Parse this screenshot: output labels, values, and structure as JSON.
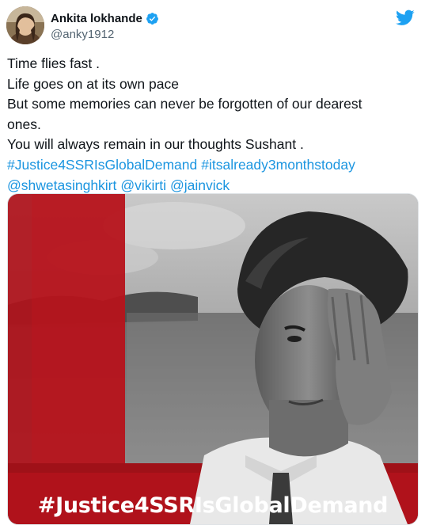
{
  "tweet": {
    "author": {
      "display_name": "Ankita lokhande",
      "handle": "@anky1912",
      "avatar_icon": "profile-photo",
      "verified_icon": "verified-badge-icon",
      "verified_color": "#1da1f2"
    },
    "platform_icon": "twitter-bird-icon",
    "platform_color": "#1da1f2",
    "text_lines": [
      "Time flies fast .",
      "Life goes on at its own pace",
      "But some memories can never be forgotten of our dearest",
      "ones.",
      "You will always remain in our thoughts Sushant ."
    ],
    "hashtags": [
      "#Justice4SSRIsGlobalDemand",
      "#itsalready3monthstoday"
    ],
    "mentions": [
      "@shwetasinghkirt",
      "@vikirti",
      "@jainvick"
    ],
    "link_color": "#1b95e0",
    "media": {
      "banner_text": "#Justice4SSRIsGlobalDemand",
      "accent_color": "#b0121b"
    }
  }
}
